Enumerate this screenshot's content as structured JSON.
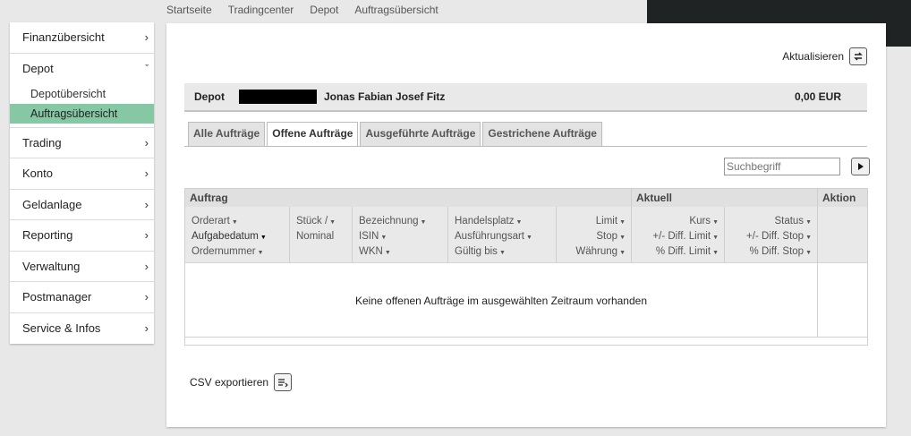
{
  "breadcrumb": [
    "Startseite",
    "Tradingcenter",
    "Depot",
    "Auftragsübersicht"
  ],
  "sidebar": {
    "top_item": "Finanzübersicht",
    "depot": {
      "label": "Depot",
      "sub": [
        "Depotübersicht",
        "Auftragsübersicht"
      ]
    },
    "items": [
      "Trading",
      "Konto",
      "Geldanlage",
      "Reporting",
      "Verwaltung",
      "Postmanager",
      "Service & Infos"
    ]
  },
  "toolbar": {
    "refresh_label": "Aktualisieren"
  },
  "depot_bar": {
    "label": "Depot",
    "owner": "Jonas Fabian Josef Fitz",
    "amount": "0,00 EUR"
  },
  "tabs": [
    "Alle Aufträge",
    "Offene Aufträge",
    "Ausgeführte Aufträge",
    "Gestrichene Aufträge"
  ],
  "active_tab": "Offene Aufträge",
  "search": {
    "placeholder": "Suchbegriff"
  },
  "table": {
    "groups": [
      "Auftrag",
      "Aktuell",
      "Aktion"
    ],
    "columns": [
      [
        "Orderart",
        "Aufgabedatum",
        "Ordernummer"
      ],
      [
        "Stück /",
        "Nominal"
      ],
      [
        "Bezeichnung",
        "ISIN",
        "WKN"
      ],
      [
        "Handelsplatz",
        "Ausführungsart",
        "Gültig bis"
      ],
      [
        "Limit",
        "Stop",
        "Währung"
      ],
      [
        "Kurs",
        "+/- Diff. Limit",
        "% Diff. Limit"
      ],
      [
        "Status",
        "+/- Diff. Stop",
        "% Diff. Stop"
      ]
    ],
    "empty_message": "Keine offenen Aufträge im ausgewählten Zeitraum vorhanden"
  },
  "export": {
    "csv_label": "CSV exportieren"
  }
}
